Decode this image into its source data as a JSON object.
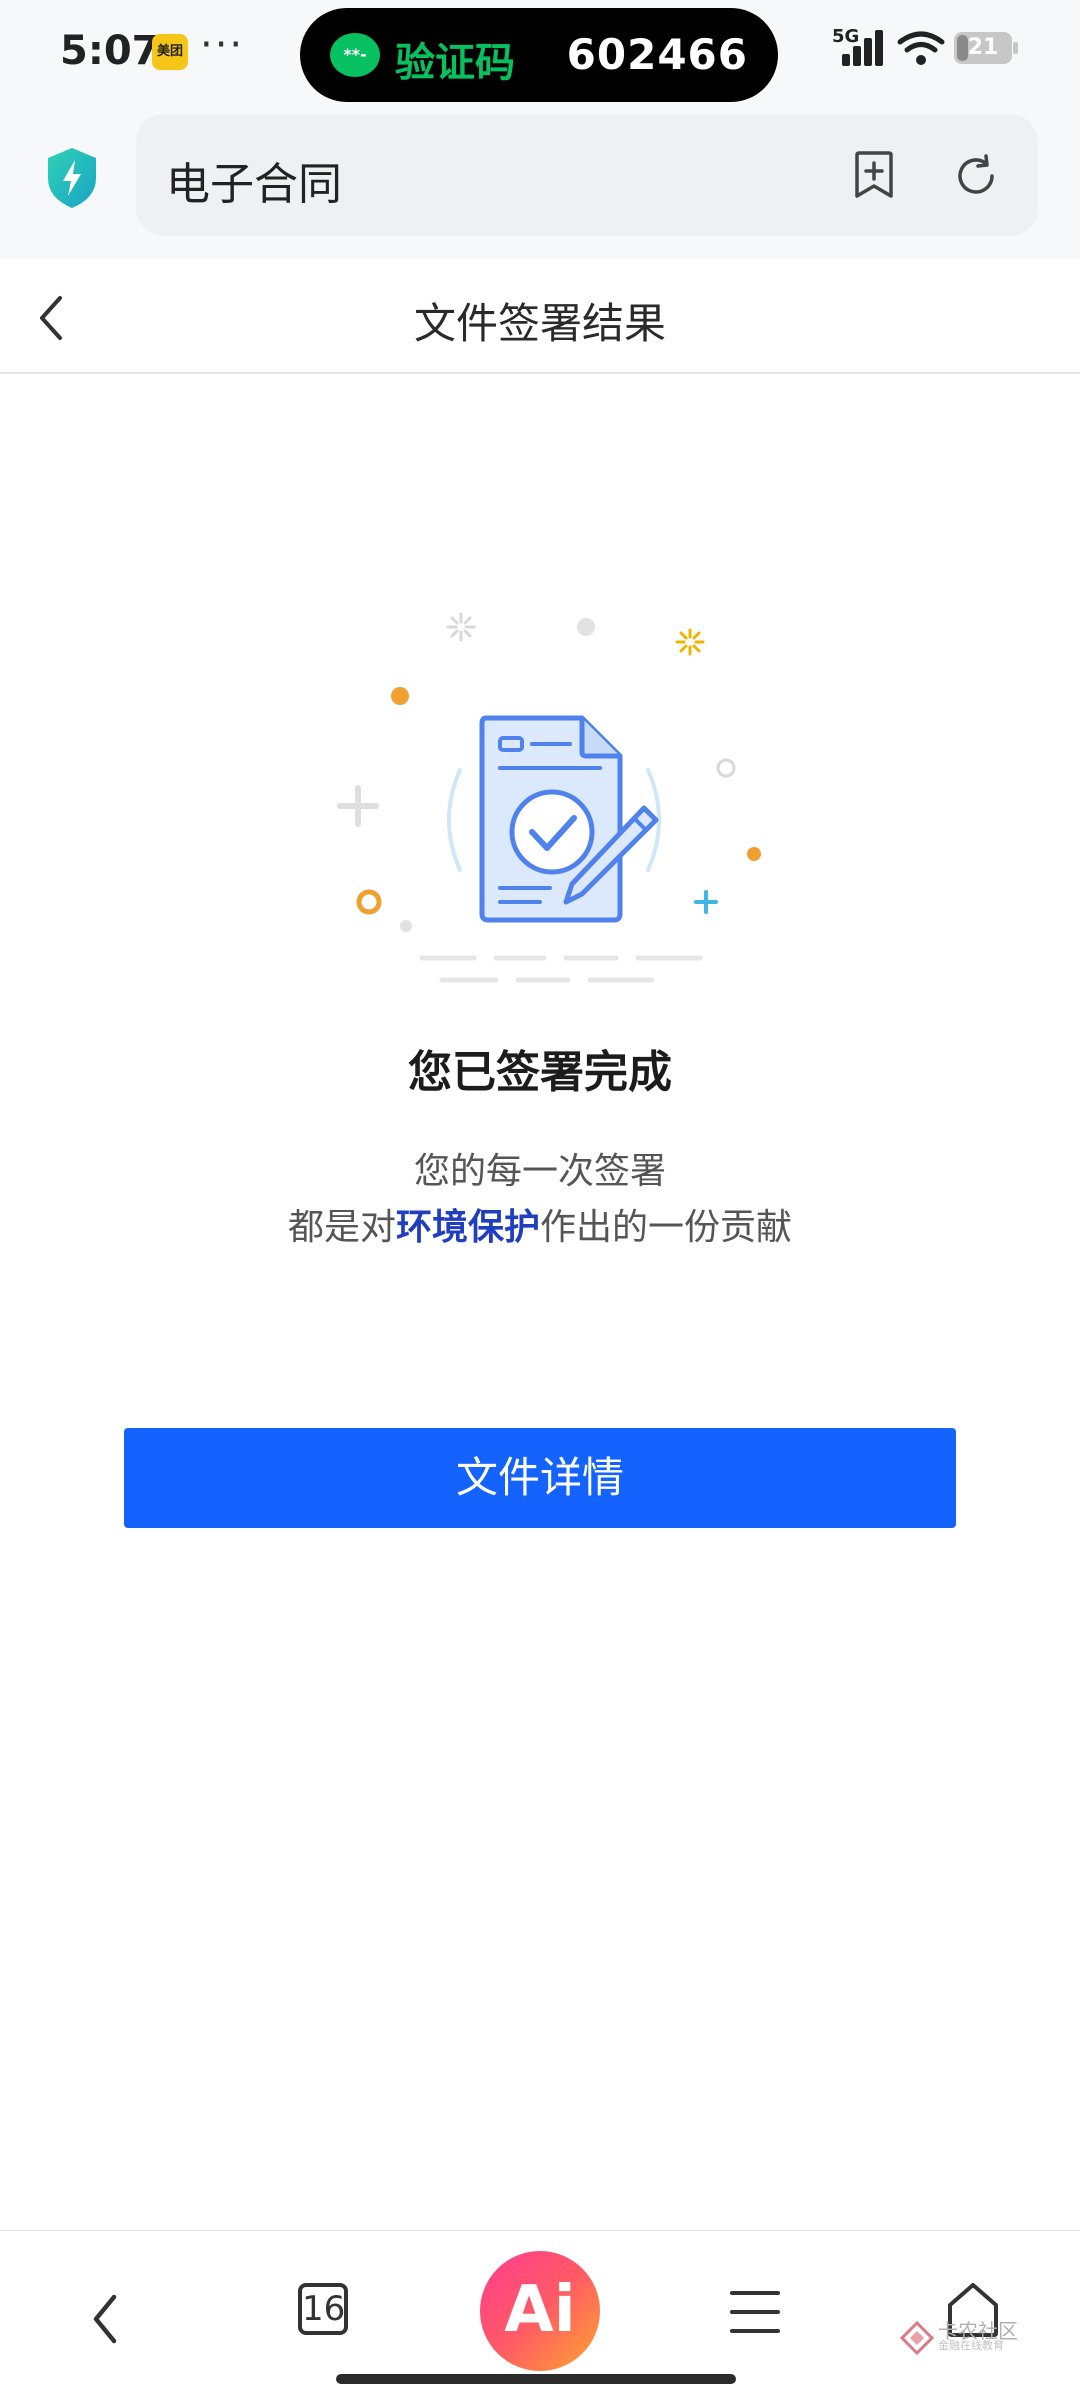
{
  "status_bar": {
    "time": "5:07",
    "app_badge": "美团",
    "dots": "···",
    "network": "5G",
    "battery": "21",
    "battery_level": 0.21
  },
  "notification": {
    "icon": "wechat-icon",
    "icon_glyph": "**-",
    "title": "验证码",
    "code": "602466"
  },
  "browser": {
    "address_text": "电子合同",
    "shield_icon": "shield-bolt-icon",
    "bookmark_icon": "bookmark-add-icon",
    "reload_icon": "reload-icon"
  },
  "header": {
    "title": "文件签署结果",
    "back_icon": "chevron-left-icon"
  },
  "result": {
    "title": "您已签署完成",
    "line1": "您的每一次签署",
    "line2_prefix": "都是对",
    "line2_highlight": "环境保护",
    "line2_suffix": "作出的一份贡献"
  },
  "actions": {
    "detail_button": "文件详情"
  },
  "bottom_nav": {
    "tab_count": "16",
    "ai_label": "Ai",
    "watermark_text": "卡农社区",
    "watermark_sub": "金融在线教育"
  },
  "colors": {
    "primary": "#1463ff",
    "highlight": "#1f3fbf",
    "wechat_green": "#07c160",
    "illustration_blue": "#4f82ec",
    "accent_orange": "#f0a030"
  }
}
